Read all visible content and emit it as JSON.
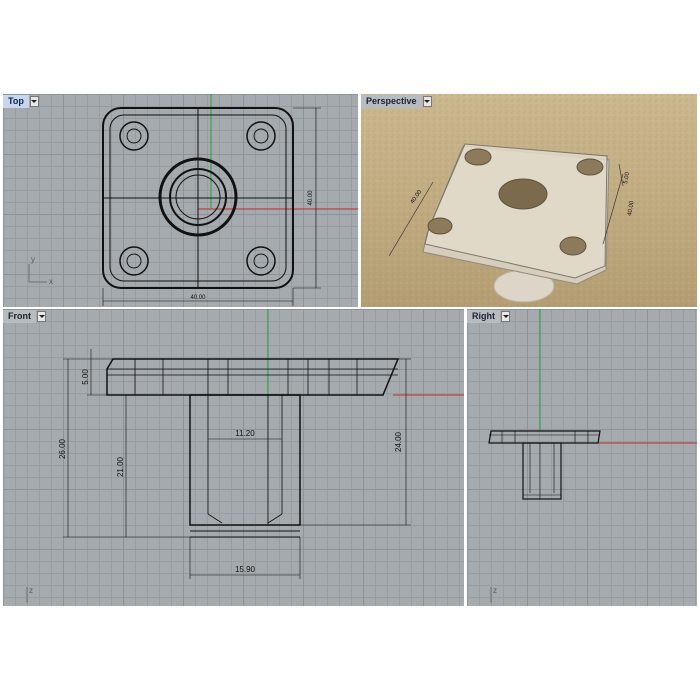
{
  "viewports": {
    "top": {
      "label": "Top",
      "active": true,
      "dims": {
        "width": "40.00",
        "height": "40.00"
      },
      "axes": {
        "y": "y",
        "x": "x"
      }
    },
    "perspective": {
      "label": "Perspective",
      "active": false,
      "dims": {
        "a": "40.00",
        "b": "40.00",
        "c": "5.00"
      }
    },
    "front": {
      "label": "Front",
      "active": false,
      "dims": {
        "d1": "5.00",
        "d2": "26.00",
        "d3": "21.00",
        "d4": "11.20",
        "d5": "24.00",
        "d6": "15.90"
      },
      "axes": {
        "z": "z"
      }
    },
    "right": {
      "label": "Right",
      "active": false,
      "axes": {
        "z": "z"
      }
    }
  },
  "colors": {
    "x_axis": "#c0262a",
    "y_axis": "#22a33a",
    "grid_bg": "#a5aaae",
    "active_tab": "#c7d6ea"
  }
}
